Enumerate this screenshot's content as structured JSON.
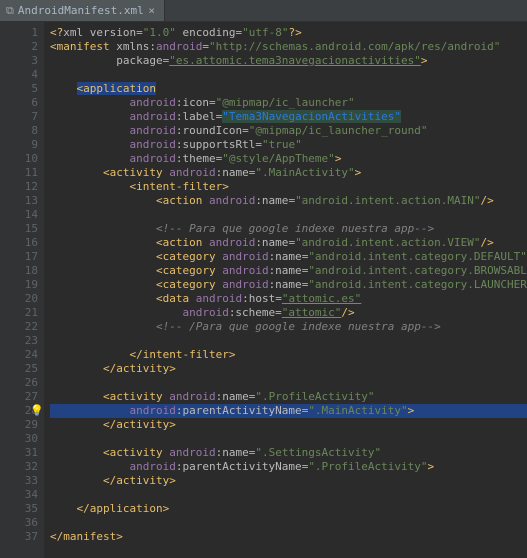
{
  "tab": {
    "filename": "AndroidManifest.xml",
    "close": "×"
  },
  "lines": {
    "l1": [
      {
        "t": "<?",
        "c": "c-tag"
      },
      {
        "t": "xml version",
        "c": "c-attr"
      },
      {
        "t": "=",
        "c": "c-def"
      },
      {
        "t": "\"1.0\"",
        "c": "c-str"
      },
      {
        "t": " encoding",
        "c": "c-attr"
      },
      {
        "t": "=",
        "c": "c-def"
      },
      {
        "t": "\"utf-8\"",
        "c": "c-str"
      },
      {
        "t": "?>",
        "c": "c-tag"
      }
    ],
    "l2": [
      {
        "t": "<manifest ",
        "c": "c-tag"
      },
      {
        "t": "xmlns:",
        "c": "c-attr"
      },
      {
        "t": "android",
        "c": "c-ns"
      },
      {
        "t": "=",
        "c": "c-def"
      },
      {
        "t": "\"http://schemas.android.com/apk/res/android\"",
        "c": "c-str"
      }
    ],
    "l3": [
      {
        "t": "          ",
        "c": ""
      },
      {
        "t": "package",
        "c": "c-attr"
      },
      {
        "t": "=",
        "c": "c-def"
      },
      {
        "t": "\"es.attomic.tema3navegacionactivities\"",
        "c": "c-str underline"
      },
      {
        "t": ">",
        "c": "c-tag"
      }
    ],
    "l4": [
      {
        "t": "",
        "c": ""
      }
    ],
    "l5": [
      {
        "t": "    ",
        "c": ""
      },
      {
        "t": "<application",
        "c": "c-tag c-sel"
      }
    ],
    "l6": [
      {
        "t": "            ",
        "c": ""
      },
      {
        "t": "android",
        "c": "c-ns"
      },
      {
        "t": ":icon",
        "c": "c-attr"
      },
      {
        "t": "=",
        "c": "c-def"
      },
      {
        "t": "\"@mipmap/ic_launcher\"",
        "c": "c-str"
      }
    ],
    "l7": [
      {
        "t": "            ",
        "c": ""
      },
      {
        "t": "android",
        "c": "c-ns"
      },
      {
        "t": ":label",
        "c": "c-attr"
      },
      {
        "t": "=",
        "c": "c-def"
      },
      {
        "t": "\"Tema3NavegacionActivities\"",
        "c": "c-hl-str"
      }
    ],
    "l8": [
      {
        "t": "            ",
        "c": ""
      },
      {
        "t": "android",
        "c": "c-ns"
      },
      {
        "t": ":roundIcon",
        "c": "c-attr"
      },
      {
        "t": "=",
        "c": "c-def"
      },
      {
        "t": "\"@mipmap/ic_launcher_round\"",
        "c": "c-str"
      }
    ],
    "l9": [
      {
        "t": "            ",
        "c": ""
      },
      {
        "t": "android",
        "c": "c-ns"
      },
      {
        "t": ":supportsRtl",
        "c": "c-attr"
      },
      {
        "t": "=",
        "c": "c-def"
      },
      {
        "t": "\"true\"",
        "c": "c-str"
      }
    ],
    "l10": [
      {
        "t": "            ",
        "c": ""
      },
      {
        "t": "android",
        "c": "c-ns"
      },
      {
        "t": ":theme",
        "c": "c-attr"
      },
      {
        "t": "=",
        "c": "c-def"
      },
      {
        "t": "\"@style/AppTheme\"",
        "c": "c-str"
      },
      {
        "t": ">",
        "c": "c-tag"
      }
    ],
    "l11": [
      {
        "t": "        ",
        "c": ""
      },
      {
        "t": "<activity ",
        "c": "c-tag"
      },
      {
        "t": "android",
        "c": "c-ns"
      },
      {
        "t": ":name",
        "c": "c-attr"
      },
      {
        "t": "=",
        "c": "c-def"
      },
      {
        "t": "\".MainActivity\"",
        "c": "c-str"
      },
      {
        "t": ">",
        "c": "c-tag"
      }
    ],
    "l12": [
      {
        "t": "            ",
        "c": ""
      },
      {
        "t": "<intent-filter>",
        "c": "c-tag"
      }
    ],
    "l13": [
      {
        "t": "                ",
        "c": ""
      },
      {
        "t": "<action ",
        "c": "c-tag"
      },
      {
        "t": "android",
        "c": "c-ns"
      },
      {
        "t": ":name",
        "c": "c-attr"
      },
      {
        "t": "=",
        "c": "c-def"
      },
      {
        "t": "\"android.intent.action.MAIN\"",
        "c": "c-str"
      },
      {
        "t": "/>",
        "c": "c-tag"
      }
    ],
    "l14": [
      {
        "t": "",
        "c": ""
      }
    ],
    "l15": [
      {
        "t": "                ",
        "c": ""
      },
      {
        "t": "<!-- Para que google indexe nuestra app-->",
        "c": "c-cmt"
      }
    ],
    "l16": [
      {
        "t": "                ",
        "c": ""
      },
      {
        "t": "<action ",
        "c": "c-tag"
      },
      {
        "t": "android",
        "c": "c-ns"
      },
      {
        "t": ":name",
        "c": "c-attr"
      },
      {
        "t": "=",
        "c": "c-def"
      },
      {
        "t": "\"android.intent.action.VIEW\"",
        "c": "c-str"
      },
      {
        "t": "/>",
        "c": "c-tag"
      }
    ],
    "l17": [
      {
        "t": "                ",
        "c": ""
      },
      {
        "t": "<category ",
        "c": "c-tag"
      },
      {
        "t": "android",
        "c": "c-ns"
      },
      {
        "t": ":name",
        "c": "c-attr"
      },
      {
        "t": "=",
        "c": "c-def"
      },
      {
        "t": "\"android.intent.category.DEFAULT\"",
        "c": "c-str"
      },
      {
        "t": "/>",
        "c": "c-tag"
      }
    ],
    "l18": [
      {
        "t": "                ",
        "c": ""
      },
      {
        "t": "<category ",
        "c": "c-tag"
      },
      {
        "t": "android",
        "c": "c-ns"
      },
      {
        "t": ":name",
        "c": "c-attr"
      },
      {
        "t": "=",
        "c": "c-def"
      },
      {
        "t": "\"android.intent.category.BROWSABLE\"",
        "c": "c-str"
      },
      {
        "t": "/>",
        "c": "c-tag"
      }
    ],
    "l19": [
      {
        "t": "                ",
        "c": ""
      },
      {
        "t": "<category ",
        "c": "c-tag"
      },
      {
        "t": "android",
        "c": "c-ns"
      },
      {
        "t": ":name",
        "c": "c-attr"
      },
      {
        "t": "=",
        "c": "c-def"
      },
      {
        "t": "\"android.intent.category.LAUNCHER\"",
        "c": "c-str"
      },
      {
        "t": "/>",
        "c": "c-tag"
      }
    ],
    "l20": [
      {
        "t": "                ",
        "c": ""
      },
      {
        "t": "<data ",
        "c": "c-tag"
      },
      {
        "t": "android",
        "c": "c-ns"
      },
      {
        "t": ":host",
        "c": "c-attr"
      },
      {
        "t": "=",
        "c": "c-def"
      },
      {
        "t": "\"attomic.es\"",
        "c": "c-str underline"
      }
    ],
    "l21": [
      {
        "t": "                    ",
        "c": ""
      },
      {
        "t": "android",
        "c": "c-ns"
      },
      {
        "t": ":scheme",
        "c": "c-attr"
      },
      {
        "t": "=",
        "c": "c-def"
      },
      {
        "t": "\"attomic\"",
        "c": "c-str underline"
      },
      {
        "t": "/>",
        "c": "c-tag"
      }
    ],
    "l22": [
      {
        "t": "                ",
        "c": ""
      },
      {
        "t": "<!-- /Para que google indexe nuestra app-->",
        "c": "c-cmt"
      }
    ],
    "l23": [
      {
        "t": "",
        "c": ""
      }
    ],
    "l24": [
      {
        "t": "            ",
        "c": ""
      },
      {
        "t": "</intent-filter>",
        "c": "c-tag"
      }
    ],
    "l25": [
      {
        "t": "        ",
        "c": ""
      },
      {
        "t": "</activity>",
        "c": "c-tag"
      }
    ],
    "l26": [
      {
        "t": "",
        "c": ""
      }
    ],
    "l27": [
      {
        "t": "        ",
        "c": ""
      },
      {
        "t": "<activity ",
        "c": "c-tag"
      },
      {
        "t": "android",
        "c": "c-ns"
      },
      {
        "t": ":name",
        "c": "c-attr"
      },
      {
        "t": "=",
        "c": "c-def"
      },
      {
        "t": "\".ProfileActivity\"",
        "c": "c-str"
      }
    ],
    "l28": [
      {
        "t": "            ",
        "c": ""
      },
      {
        "t": "android",
        "c": "c-ns"
      },
      {
        "t": ":parentActivityName",
        "c": "c-attr"
      },
      {
        "t": "=",
        "c": "c-def"
      },
      {
        "t": "\".MainActivity\"",
        "c": "c-str"
      },
      {
        "t": ">",
        "c": "c-tag"
      }
    ],
    "l29": [
      {
        "t": "        ",
        "c": ""
      },
      {
        "t": "</activity>",
        "c": "c-tag"
      }
    ],
    "l30": [
      {
        "t": "",
        "c": ""
      }
    ],
    "l31": [
      {
        "t": "        ",
        "c": ""
      },
      {
        "t": "<activity ",
        "c": "c-tag"
      },
      {
        "t": "android",
        "c": "c-ns"
      },
      {
        "t": ":name",
        "c": "c-attr"
      },
      {
        "t": "=",
        "c": "c-def"
      },
      {
        "t": "\".SettingsActivity\"",
        "c": "c-str"
      }
    ],
    "l32": [
      {
        "t": "            ",
        "c": ""
      },
      {
        "t": "android",
        "c": "c-ns"
      },
      {
        "t": ":parentActivityName",
        "c": "c-attr"
      },
      {
        "t": "=",
        "c": "c-def"
      },
      {
        "t": "\".ProfileActivity\"",
        "c": "c-str"
      },
      {
        "t": ">",
        "c": "c-tag"
      }
    ],
    "l33": [
      {
        "t": "        ",
        "c": ""
      },
      {
        "t": "</activity>",
        "c": "c-tag"
      }
    ],
    "l34": [
      {
        "t": "",
        "c": ""
      }
    ],
    "l35": [
      {
        "t": "    ",
        "c": ""
      },
      {
        "t": "</application>",
        "c": "c-tag"
      }
    ],
    "l36": [
      {
        "t": "",
        "c": ""
      }
    ],
    "l37": [
      {
        "t": "</manifest>",
        "c": "c-tag"
      }
    ]
  },
  "lineCount": 37,
  "highlightLine": 28,
  "bulbLine": 28
}
